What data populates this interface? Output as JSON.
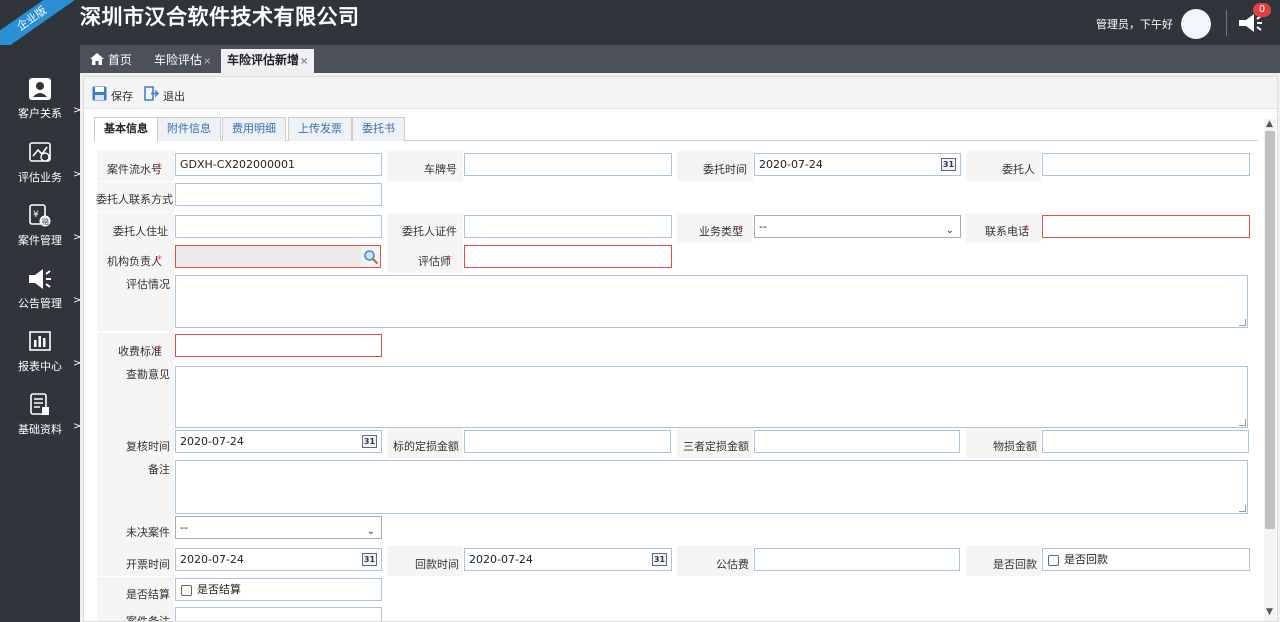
{
  "header": {
    "ribbon": "企业版",
    "company": "深圳市汉合软件技术有限公司",
    "greeting": "管理员，下午好",
    "badge": "0"
  },
  "sidebar": {
    "items": [
      {
        "label": "客户关系",
        "icon": "person-icon"
      },
      {
        "label": "评估业务",
        "icon": "chart-icon"
      },
      {
        "label": "案件管理",
        "icon": "case-icon"
      },
      {
        "label": "公告管理",
        "icon": "megaphone-icon"
      },
      {
        "label": "报表中心",
        "icon": "report-icon"
      },
      {
        "label": "基础资料",
        "icon": "document-icon"
      }
    ],
    "arrow": ">"
  },
  "tabs": {
    "home": "首页",
    "tab1": "车险评估",
    "tab2": "车险评估新增",
    "close": "×"
  },
  "toolbar": {
    "save": "保存",
    "exit": "退出"
  },
  "inner_tabs": [
    "基本信息",
    "附件信息",
    "费用明细",
    "上传发票",
    "委托书"
  ],
  "form": {
    "req": "*",
    "case_no_label": "案件流水号",
    "case_no_value": "GDXH-CX202000001",
    "plate_label": "车牌号",
    "entrust_time_label": "委托时间",
    "entrust_time_value": "2020-07-24",
    "client_label": "委托人",
    "client_contact_label": "委托人联系方式",
    "client_address_label": "委托人住址",
    "client_id_label": "委托人证件",
    "biz_type_label": "业务类型",
    "biz_type_value": "--",
    "phone_label": "联系电话",
    "org_head_label": "机构负责人",
    "assessor_label": "评估师",
    "situation_label": "评估情况",
    "fee_std_label": "收费标准",
    "survey_label": "查勘意见",
    "review_time_label": "复核时间",
    "review_time_value": "2020-07-24",
    "target_loss_label": "标的定损金额",
    "third_loss_label": "三者定损金额",
    "property_loss_label": "物损金额",
    "remark_label": "备注",
    "pending_label": "未决案件",
    "pending_value": "--",
    "invoice_time_label": "开票时间",
    "invoice_time_value": "2020-07-24",
    "payback_time_label": "回款时间",
    "payback_time_value": "2020-07-24",
    "public_fee_label": "公估费",
    "is_paid_label": "是否回款",
    "is_paid_chk": "是否回款",
    "is_settled_label": "是否结算",
    "is_settled_chk": "是否结算",
    "case_remark_label": "案件备注",
    "cal_glyph": "31"
  }
}
